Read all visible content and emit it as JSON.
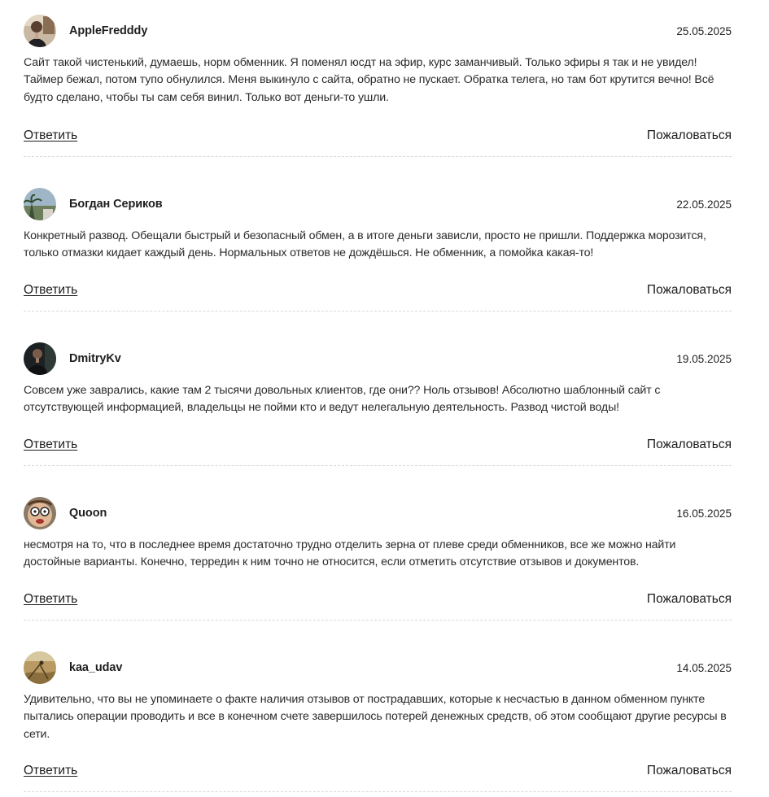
{
  "reviews": [
    {
      "author": "AppleFredddy",
      "date": "25.05.2025",
      "text": "Сайт такой чистенький, думаешь, норм обменник. Я поменял юсдт на эфир, курс заманчивый. Только эфиры я так и не увидел! Таймер бежал, потом тупо обнулился. Меня выкинуло с сайта, обратно не пускает. Обратка телега, но там бот крутится вечно! Всё будто сделано, чтобы ты сам себя винил. Только вот деньги-то ушли.",
      "reply_label": "Ответить",
      "complain_label": "Пожаловаться"
    },
    {
      "author": "Богдан Сериков",
      "date": "22.05.2025",
      "text": "Конкретный развод. Обещали быстрый и безопасный обмен, а в итоге деньги зависли, просто не пришли. Поддержка морозится, только отмазки кидает каждый день. Нормальных ответов не дождёшься. Не обменник, а помойка какая-то!",
      "reply_label": "Ответить",
      "complain_label": "Пожаловаться"
    },
    {
      "author": "DmitryKv",
      "date": "19.05.2025",
      "text": "Совсем уже заврались, какие там 2 тысячи довольных клиентов, где они?? Ноль отзывов! Абсолютно шаблонный сайт с отсутствующей информацией, владельцы не пойми кто и ведут нелегальную деятельность. Развод чистой воды!",
      "reply_label": "Ответить",
      "complain_label": "Пожаловаться"
    },
    {
      "author": "Quoon",
      "date": "16.05.2025",
      "text": "несмотря на то, что в последнее время достаточно трудно отделить зерна от плеве среди обменников, все же можно найти достойные варианты. Конечно, терредин к ним точно не относится, если отметить отсутствие отзывов и документов.",
      "reply_label": "Ответить",
      "complain_label": "Пожаловаться"
    },
    {
      "author": "kaa_udav",
      "date": "14.05.2025",
      "text": "Удивительно, что вы не упоминаете о факте наличия отзывов от пострадавших, которые к несчастью в данном обменном пункте пытались операции проводить и все в конечном счете завершилось потерей денежных средств, об этом сообщают другие ресурсы в сети.",
      "reply_label": "Ответить",
      "complain_label": "Пожаловаться"
    }
  ]
}
